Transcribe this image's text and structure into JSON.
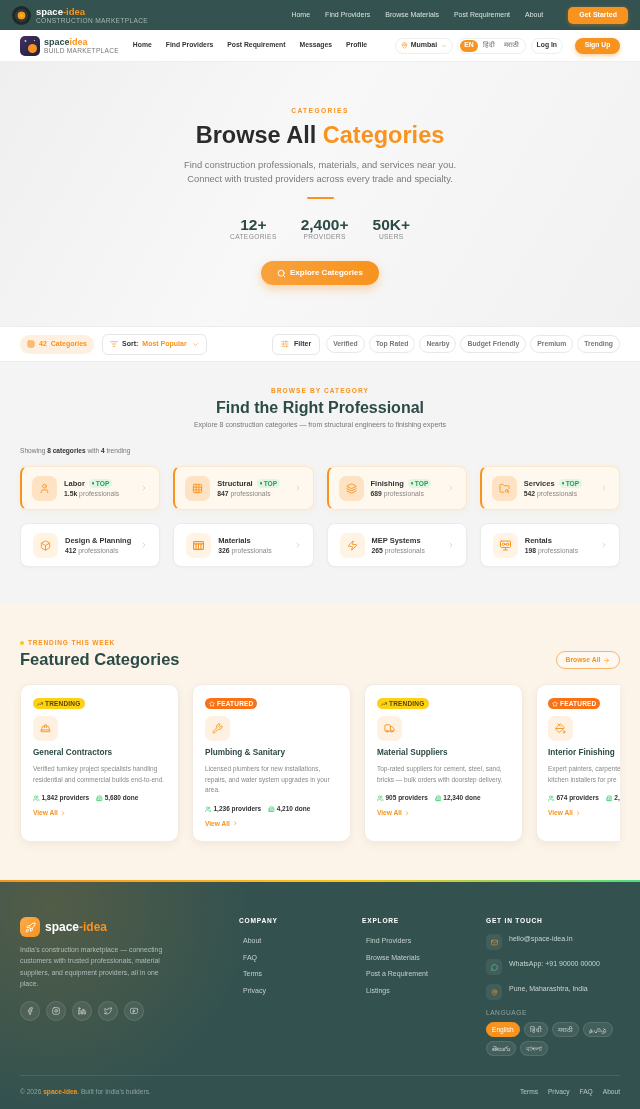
{
  "top_bar": {
    "brand": "space",
    "brand_accent": "-idea",
    "tagline": "CONSTRUCTION MARKETPLACE",
    "nav": [
      "Home",
      "Find Providers",
      "Browse Materials",
      "Post Requirement",
      "About"
    ],
    "cta": "Get Started"
  },
  "main_nav": {
    "brand": "space",
    "brand_accent": "idea",
    "tagline": "BUILD MARKETPLACE",
    "links": [
      "Home",
      "Find Providers",
      "Post Requirement",
      "Messages",
      "Profile"
    ],
    "location": "Mumbai",
    "languages": [
      {
        "label": "EN",
        "selected": true
      },
      {
        "label": "हिंदी",
        "selected": false
      },
      {
        "label": "मराठी",
        "selected": false
      }
    ],
    "login": "Log In",
    "signup": "Sign Up"
  },
  "hero": {
    "eyebrow": "CATEGORIES",
    "title": "Browse All",
    "title_accent": "Categories",
    "subtitle": "Find construction professionals, materials, and services near you. Connect with trusted providers across every trade and specialty.",
    "stats": [
      {
        "value": "12+",
        "label": "CATEGORIES"
      },
      {
        "value": "2,400+",
        "label": "PROVIDERS"
      },
      {
        "value": "50K+",
        "label": "USERS"
      }
    ],
    "button": "Explore Categories"
  },
  "filter_bar": {
    "count": "42",
    "count_label": "Categories",
    "sort_label": "Sort:",
    "sort_value": "Most Popular",
    "filter": "Filter",
    "chips": [
      {
        "label": "Verified",
        "selected": false
      },
      {
        "label": "Top Rated",
        "selected": false
      },
      {
        "label": "Nearby",
        "selected": false
      },
      {
        "label": "Budget Friendly",
        "selected": false
      },
      {
        "label": "Premium",
        "selected": false
      },
      {
        "label": "Trending",
        "selected": false
      }
    ]
  },
  "browse": {
    "eyebrow": "BROWSE BY CATEGORY",
    "title": "Find the Right Professional",
    "subtitle": "Explore 8 construction categories — from structural engineers to finishing experts",
    "summary": "Showing **8 categories** with **4** trending",
    "categories": [
      {
        "name": "Labor",
        "badge": "TOP",
        "count": "**1.5k** professionals",
        "trending": true
      },
      {
        "name": "Structural",
        "badge": "TOP",
        "count": "**847** professionals",
        "trending": true
      },
      {
        "name": "Finishing",
        "badge": "TOP",
        "count": "**689** professionals",
        "trending": true
      },
      {
        "name": "Services",
        "badge": "TOP",
        "count": "**542** professionals",
        "trending": true
      },
      {
        "name": "Design & Planning",
        "count": "**412** professionals",
        "trending": false
      },
      {
        "name": "Materials",
        "count": "**326** professionals",
        "trending": false
      },
      {
        "name": "MEP Systems",
        "count": "**265** professionals",
        "trending": false
      },
      {
        "name": "Rentals",
        "count": "**198** professionals",
        "trending": false
      }
    ]
  },
  "featured": {
    "eyebrow": "TRENDING THIS WEEK",
    "title": "Featured Categories",
    "browse_all": "Browse All",
    "cards": [
      {
        "badge": {
          "kind": "trending",
          "label": "TRENDING"
        },
        "title": "General Contractors",
        "description": "Verified turnkey project specialists handling residential and commercial builds end-to-end.",
        "providers": "1,842 providers",
        "done": "5,680 done",
        "link": "View All"
      },
      {
        "badge": {
          "kind": "featured",
          "label": "FEATURED"
        },
        "title": "Plumbing & Sanitary",
        "description": "Licensed plumbers for new installations, repairs, and water system upgrades in your area.",
        "providers": "1,236 providers",
        "done": "4,210 done",
        "link": "View All"
      },
      {
        "badge": {
          "kind": "trending",
          "label": "TRENDING"
        },
        "title": "Material Suppliers",
        "description": "Top-rated suppliers for cement, steel, sand, bricks — bulk orders with doorstep delivery.",
        "providers": "905 providers",
        "done": "12,340 done",
        "link": "View All"
      },
      {
        "badge": {
          "kind": "featured",
          "label": "FEATURED"
        },
        "title": "Interior Finishing",
        "description": "Expert painters, carpente\nkitchen installers for pre",
        "providers": "674 providers",
        "done": "2,",
        "link": "View All"
      }
    ]
  },
  "footer": {
    "brand": "space",
    "brand_accent": "-idea",
    "description": "India's construction marketplace — connecting customers with trusted professionals, material suppliers, and equipment providers, all in one place.",
    "columns": [
      {
        "heading": "COMPANY",
        "links": [
          "About",
          "FAQ",
          "Terms",
          "Privacy"
        ]
      },
      {
        "heading": "EXPLORE",
        "links": [
          "Find Providers",
          "Browse Materials",
          "Post a Requirement",
          "Listings"
        ]
      }
    ],
    "contact": {
      "heading": "GET IN TOUCH",
      "items": [
        "hello@space-idea.in",
        "WhatsApp: +91 90000 00000",
        "Pune, Maharashtra, India"
      ]
    },
    "language_label": "LANGUAGE",
    "languages": [
      {
        "label": "English",
        "selected": true
      },
      {
        "label": "हिंदी",
        "selected": false
      },
      {
        "label": "मराठी",
        "selected": false
      },
      {
        "label": "தமிழ்",
        "selected": false
      },
      {
        "label": "తెలుగు",
        "selected": false
      },
      {
        "label": "বাংলা",
        "selected": false
      }
    ],
    "copyright": "© 2026 **space-idea**. Built for India's builders.",
    "bottom_links": [
      "Terms",
      "Privacy",
      "FAQ",
      "About"
    ]
  }
}
